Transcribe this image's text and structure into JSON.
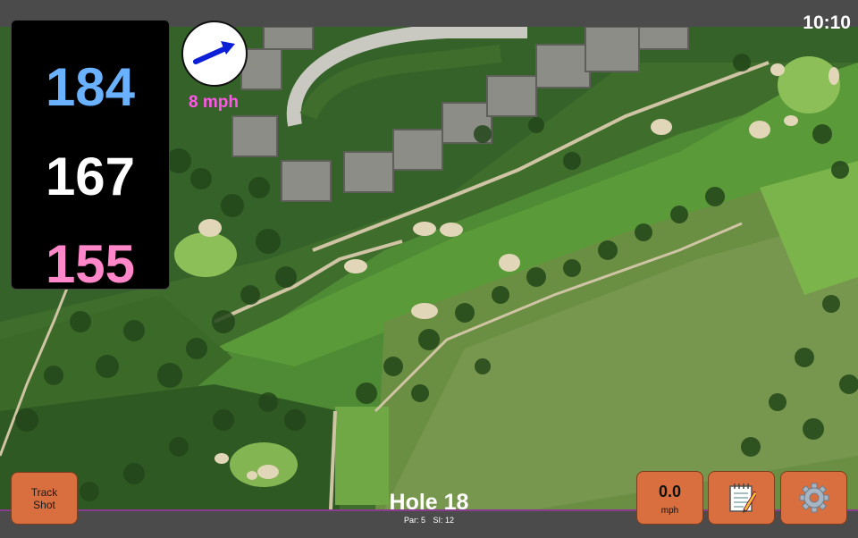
{
  "status": {
    "time": "10:10"
  },
  "distances": {
    "back": "184",
    "middle": "167",
    "front": "155"
  },
  "wind": {
    "speed_label": "8 mph",
    "direction_icon": "wind-arrow-icon"
  },
  "hole": {
    "title": "Hole 18",
    "par": "Par: 5",
    "stroke_index": "SI: 12"
  },
  "buttons": {
    "track_shot": "Track Shot",
    "speed_value": "0.0",
    "speed_unit": "mph",
    "notes_icon": "notepad-icon",
    "settings_icon": "gear-icon"
  },
  "colors": {
    "back_distance": "#6ab1ff",
    "middle_distance": "#ffffff",
    "front_distance": "#ff86c8",
    "wind_label": "#ff57e8",
    "button": "#d96f3e",
    "bar_accent": "#8a3b8f"
  }
}
